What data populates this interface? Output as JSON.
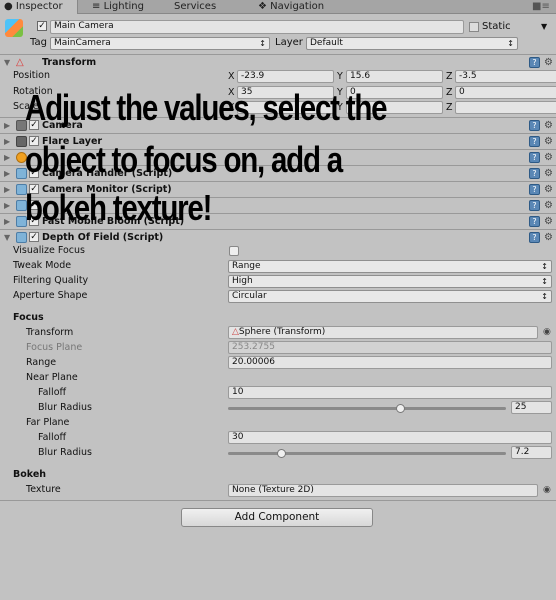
{
  "tabs": [
    {
      "label": "Inspector",
      "icon": "info-icon",
      "active": true
    },
    {
      "label": "Lighting",
      "icon": "lighting-icon"
    },
    {
      "label": "Services"
    },
    {
      "label": "Navigation",
      "icon": "navigation-icon"
    }
  ],
  "object": {
    "name": "Main Camera",
    "active": true,
    "static_label": "Static",
    "static": false,
    "tag_label": "Tag",
    "tag": "MainCamera",
    "layer_label": "Layer",
    "layer": "Default"
  },
  "transform": {
    "title": "Transform",
    "rows": [
      {
        "label": "Position",
        "x": "-23.9",
        "y": "15.6",
        "z": "-3.5"
      },
      {
        "label": "Rotation",
        "x": "35",
        "y": "0",
        "z": "0"
      },
      {
        "label": "Scale",
        "x": "",
        "y": "",
        "z": ""
      }
    ]
  },
  "components": [
    {
      "name": "Camera",
      "icon": "camera-icon"
    },
    {
      "name": "Flare Layer",
      "icon": "flare-icon"
    },
    {
      "name": "",
      "icon": "audio-listener-icon"
    },
    {
      "name": "Camera Handler (Script)",
      "icon": "script-icon"
    },
    {
      "name": "Camera Monitor (Script)",
      "icon": "script-icon"
    },
    {
      "name": "",
      "icon": "script-icon"
    },
    {
      "name": "Fast Mobile Bloom (Script)",
      "icon": "script-icon"
    }
  ],
  "dof": {
    "title": "Depth Of Field (Script)",
    "visualize_focus": {
      "label": "Visualize Focus",
      "checked": false
    },
    "tweak_mode": {
      "label": "Tweak Mode",
      "value": "Range"
    },
    "filtering": {
      "label": "Filtering Quality",
      "value": "High"
    },
    "aperture": {
      "label": "Aperture Shape",
      "value": "Circular"
    },
    "focus_header": "Focus",
    "transform": {
      "label": "Transform",
      "value": "Sphere (Transform)"
    },
    "focus_plane": {
      "label": "Focus Plane",
      "value": "253.2755"
    },
    "range": {
      "label": "Range",
      "value": "20.00006"
    },
    "near_header": "Near Plane",
    "near_falloff": {
      "label": "Falloff",
      "value": "10"
    },
    "near_blur": {
      "label": "Blur Radius",
      "value": "25",
      "fraction": 0.62
    },
    "far_header": "Far Plane",
    "far_falloff": {
      "label": "Falloff",
      "value": "30"
    },
    "far_blur": {
      "label": "Blur Radius",
      "value": "7.2",
      "fraction": 0.19
    },
    "bokeh_header": "Bokeh",
    "texture": {
      "label": "Texture",
      "value": "None (Texture 2D)"
    }
  },
  "add_component": "Add Component",
  "overlay": [
    "Adjust the values, select the",
    "object to focus on, add a",
    "bokeh texture!"
  ]
}
